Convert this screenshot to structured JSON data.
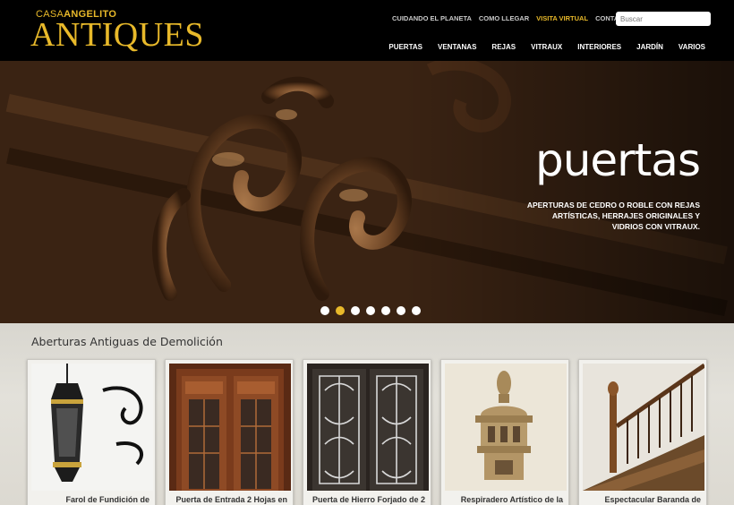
{
  "brand": {
    "casa": "CASA",
    "angelito": "ANGELITO",
    "antiques": "ANTIQUES"
  },
  "topnav": [
    "CUIDANDO EL PLANETA",
    "COMO LLEGAR",
    "VISITA VIRTUAL",
    "CONTACTO"
  ],
  "search": {
    "placeholder": "Buscar"
  },
  "mainnav": [
    "PUERTAS",
    "VENTANAS",
    "REJAS",
    "VITRAUX",
    "INTERIORES",
    "JARDÍN",
    "VARIOS"
  ],
  "hero": {
    "title": "puertas",
    "text": "APERTURAS DE CEDRO O ROBLE CON REJAS ARTÍSTICAS, HERRAJES ORIGINALES Y VIDRIOS CON VITRAUX.",
    "active_slide": 2,
    "slide_count": 7
  },
  "section": {
    "title": "Aberturas Antiguas de Demolición",
    "cards": [
      {
        "caption": "Farol de Fundición de",
        "icon": "lantern-photo"
      },
      {
        "caption": "Puerta de Entrada 2 Hojas en",
        "icon": "wooden-door-photo"
      },
      {
        "caption": "Puerta de Hierro Forjado de 2",
        "icon": "iron-door-photo"
      },
      {
        "caption": "Respiradero Artístico de la",
        "icon": "stone-vent-photo"
      },
      {
        "caption": "Espectacular Baranda de",
        "icon": "staircase-photo"
      }
    ]
  },
  "colors": {
    "accent": "#e8b92a",
    "header_bg": "#000000"
  }
}
